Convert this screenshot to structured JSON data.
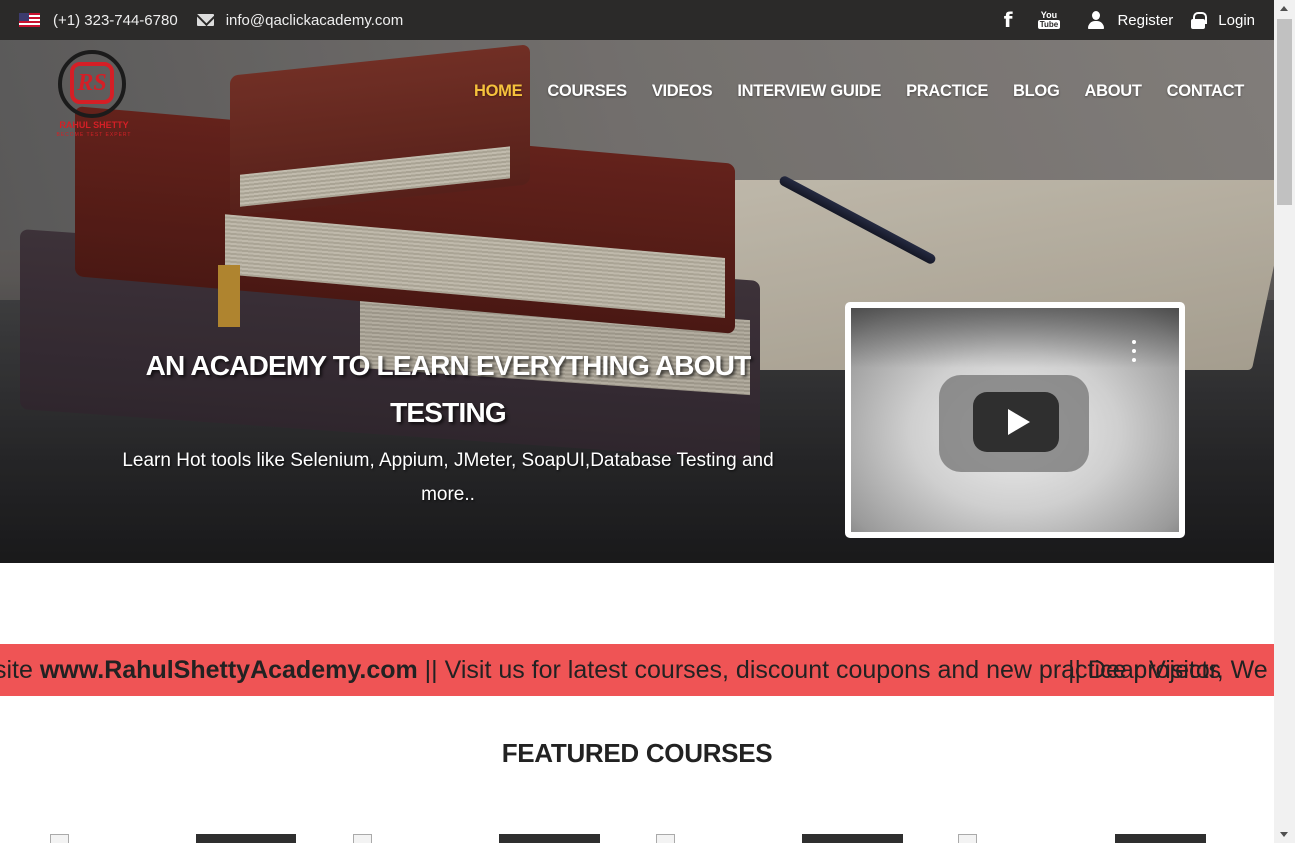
{
  "topbar": {
    "phone": "(+1) 323-744-6780",
    "email": "info@qaclickacademy.com",
    "register": "Register",
    "login": "Login",
    "youtube_you": "You",
    "youtube_tube": "Tube"
  },
  "logo": {
    "monogram": "RS",
    "brand": "RAHUL SHETTY",
    "tagline": "BECOME TEST EXPERT"
  },
  "nav": {
    "items": [
      "HOME",
      "COURSES",
      "VIDEOS",
      "INTERVIEW GUIDE",
      "PRACTICE",
      "BLOG",
      "ABOUT",
      "CONTACT"
    ],
    "active": "HOME"
  },
  "hero": {
    "title": "AN ACADEMY TO LEARN EVERYTHING ABOUT TESTING",
    "subtitle": "Learn Hot tools like Selenium, Appium, JMeter, SoapUI,Database Testing and more.."
  },
  "marquee": {
    "prefix": "site ",
    "site": "www.RahulShettyAcademy.com",
    "suffix": " || Visit us for latest courses, discount coupons and new practi",
    "overlap": "ce projects",
    "next": "|| Dear Visitor, We"
  },
  "featured": {
    "title": "FEATURED COURSES"
  },
  "colors": {
    "topbar_bg": "#2b2a29",
    "nav_active": "#f6c23c",
    "marquee_bg": "#ef5455",
    "brand_red": "#d51f26"
  },
  "icons": [
    "us-flag-icon",
    "envelope-icon",
    "facebook-icon",
    "youtube-icon",
    "user-icon",
    "lock-icon",
    "play-icon",
    "more-vert-icon"
  ]
}
